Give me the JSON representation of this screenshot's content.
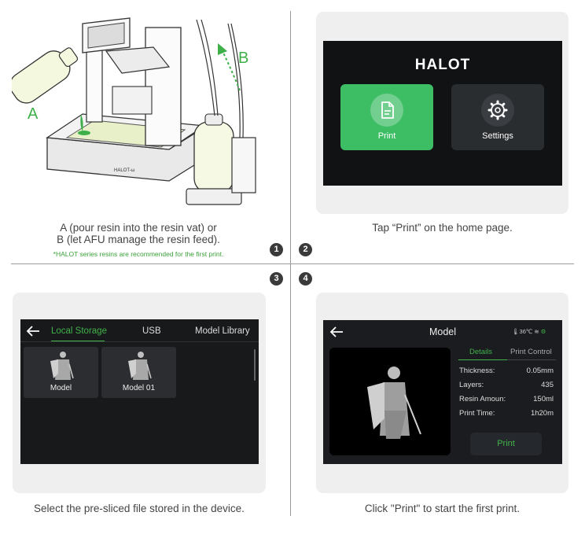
{
  "panel1": {
    "label_a": "A",
    "label_b": "B",
    "printer_badge": "HALOT-ω",
    "caption_line1": "A (pour resin into the resin vat) or",
    "caption_line2": "B (let AFU manage the resin feed).",
    "note": "*HALOT series resins are recommended for the first print."
  },
  "panel2": {
    "brand": "HALOT",
    "print_label": "Print",
    "settings_label": "Settings",
    "caption": "Tap “Print” on the home page.",
    "print_tile_color": "#3dbd64",
    "settings_tile_color": "#2a2d30"
  },
  "panel3": {
    "tabs": [
      "Local Storage",
      "USB",
      "Model Library"
    ],
    "files": [
      "Model",
      "Model 01"
    ],
    "caption": "Select the pre-sliced file stored in the device."
  },
  "panel4": {
    "title": "Model",
    "status": "36℃",
    "tabs": [
      "Details",
      "Print Control"
    ],
    "details": [
      {
        "label": "Thickness:",
        "value": "0.05mm"
      },
      {
        "label": "Layers:",
        "value": "435"
      },
      {
        "label": "Resin Amoun:",
        "value": "150ml"
      },
      {
        "label": "Print Time:",
        "value": "1h20m"
      }
    ],
    "print_label": "Print",
    "caption": "Click \"Print\" to start the first print."
  },
  "steps": [
    "1",
    "2",
    "3",
    "4"
  ],
  "accent": "#41b24a"
}
